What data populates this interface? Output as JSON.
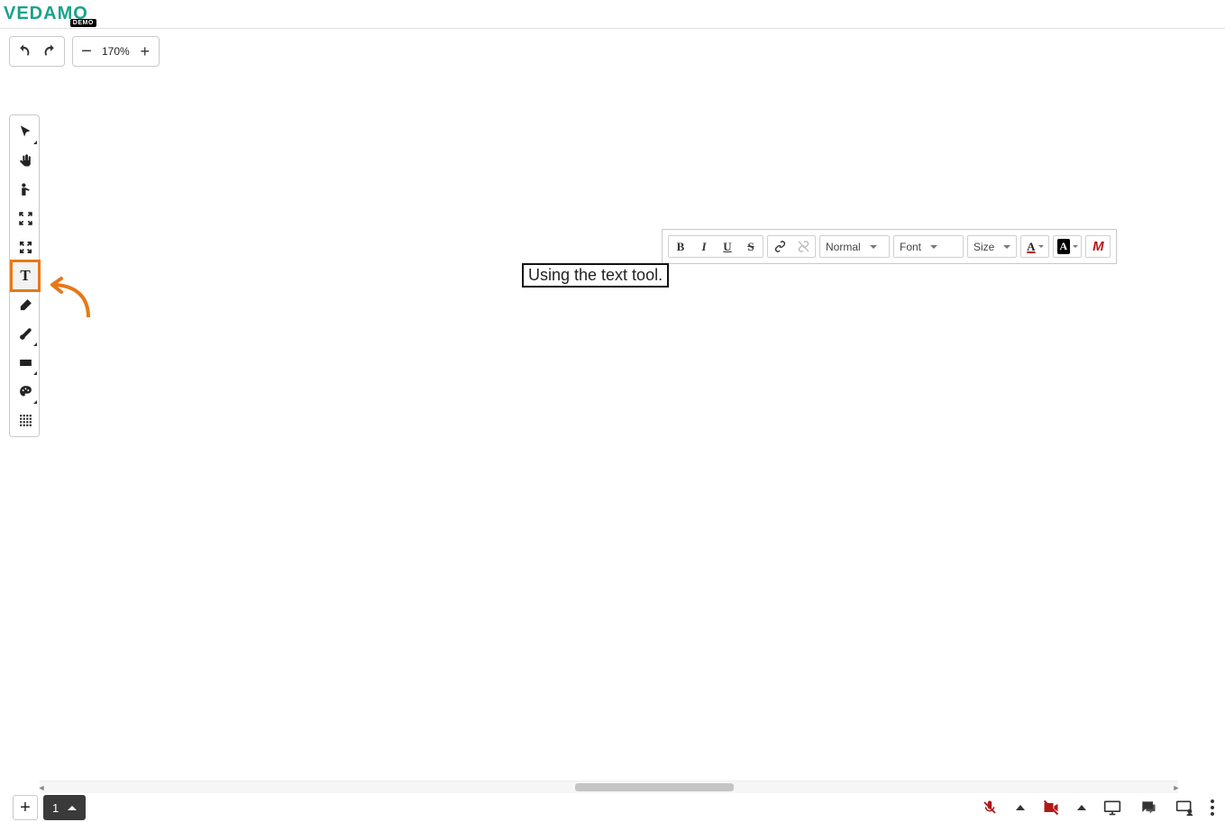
{
  "brand": {
    "name": "VEDAMO",
    "tag": "DEMO"
  },
  "top_toolbar": {
    "zoom_level": "170%"
  },
  "left_tools": [
    {
      "id": "select",
      "name": "select-tool",
      "has_sub": true
    },
    {
      "id": "hand",
      "name": "hand-tool",
      "has_sub": false
    },
    {
      "id": "pointer",
      "name": "pointer-tool",
      "has_sub": false
    },
    {
      "id": "gather",
      "name": "bring-all-tool",
      "has_sub": false
    },
    {
      "id": "scatter",
      "name": "spread-all-tool",
      "has_sub": false
    },
    {
      "id": "text",
      "name": "text-tool",
      "has_sub": false,
      "active": true
    },
    {
      "id": "eraser",
      "name": "eraser-tool",
      "has_sub": false
    },
    {
      "id": "brush",
      "name": "brush-tool",
      "has_sub": true
    },
    {
      "id": "shape",
      "name": "shape-tool",
      "has_sub": true
    },
    {
      "id": "color",
      "name": "color-palette-tool",
      "has_sub": true
    },
    {
      "id": "grid",
      "name": "grid-tool",
      "has_sub": false
    }
  ],
  "format_toolbar": {
    "style_label": "Normal",
    "font_label": "Font",
    "size_label": "Size"
  },
  "canvas": {
    "text_box_content": "Using the text tool."
  },
  "bottom_bar": {
    "current_page": "1"
  }
}
